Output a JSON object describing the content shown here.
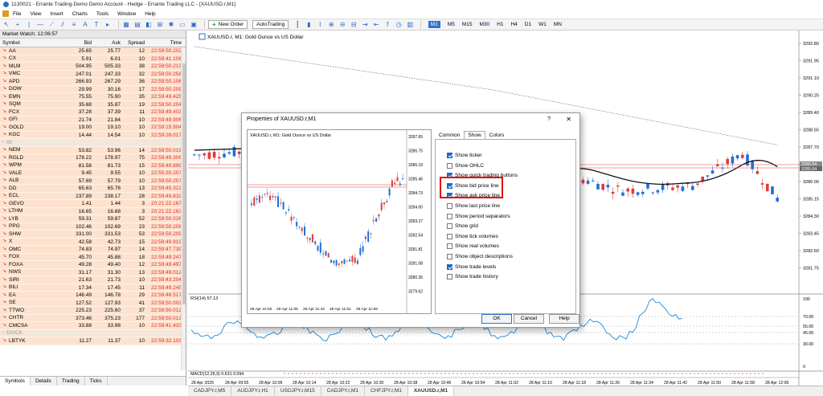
{
  "window": {
    "title": "1130021 - Errante Trading-Demo Demo Account - Hedge - Errante Trading LLC - [XAUUSD.r,M1]"
  },
  "menu": [
    "File",
    "View",
    "Insert",
    "Charts",
    "Tools",
    "Window",
    "Help"
  ],
  "toolbar": {
    "new_order": "New Order",
    "autotrading": "AutoTrading",
    "timeframes": [
      "M1",
      "M5",
      "M15",
      "M30",
      "H1",
      "H4",
      "D1",
      "W1",
      "MN"
    ],
    "active_tf": "M1"
  },
  "market_watch": {
    "title": "Market Watch: 12:06:57",
    "headers": {
      "symbol": "Symbol",
      "bid": "Bid",
      "ask": "Ask",
      "spread": "Spread",
      "time": "Time"
    },
    "rows": [
      {
        "s": "AA",
        "b": "25.65",
        "a": "25.77",
        "sp": "12",
        "t": "22:59:50.202"
      },
      {
        "s": "CX",
        "b": "5.91",
        "a": "6.01",
        "sp": "10",
        "t": "22:59:41.106"
      },
      {
        "s": "MLM",
        "b": "504.95",
        "a": "505.33",
        "sp": "38",
        "t": "22:59:50.213"
      },
      {
        "s": "VMC",
        "b": "247.01",
        "a": "247.33",
        "sp": "32",
        "t": "22:59:50.258"
      },
      {
        "s": "APD",
        "b": "266.93",
        "a": "267.29",
        "sp": "36",
        "t": "22:59:50.106"
      },
      {
        "s": "DOW",
        "b": "29.99",
        "a": "30.16",
        "sp": "17",
        "t": "22:59:50.209"
      },
      {
        "s": "EMN",
        "b": "75.55",
        "a": "75.90",
        "sp": "35",
        "t": "22:59:49.425"
      },
      {
        "s": "SQM",
        "b": "35.68",
        "a": "35.87",
        "sp": "19",
        "t": "22:59:50.204"
      },
      {
        "s": "FCX",
        "b": "37.28",
        "a": "37.39",
        "sp": "11",
        "t": "22:59:49.403"
      },
      {
        "s": "GFI",
        "b": "21.74",
        "a": "21.84",
        "sp": "10",
        "t": "22:59:49.906"
      },
      {
        "s": "GOLD",
        "b": "19.00",
        "a": "19.10",
        "sp": "10",
        "t": "22:59:15.904"
      },
      {
        "s": "KGC",
        "b": "14.44",
        "a": "14.54",
        "sp": "10",
        "t": "22:59:28.017"
      },
      {
        "s": "IG",
        "b": "",
        "a": "",
        "sp": "",
        "t": "",
        "gray": true
      },
      {
        "s": "NEM",
        "b": "53.82",
        "a": "53.96",
        "sp": "14",
        "t": "22:59:50.019"
      },
      {
        "s": "RGLD",
        "b": "178.22",
        "a": "178.97",
        "sp": "75",
        "t": "22:59:49.306"
      },
      {
        "s": "WPM",
        "b": "81.58",
        "a": "81.73",
        "sp": "15",
        "t": "22:59:49.899"
      },
      {
        "s": "VALE",
        "b": "9.45",
        "a": "9.55",
        "sp": "10",
        "t": "22:55:30.207"
      },
      {
        "s": "ALB",
        "b": "57.69",
        "a": "57.79",
        "sp": "10",
        "t": "22:59:50.207"
      },
      {
        "s": "DD",
        "b": "65.63",
        "a": "65.76",
        "sp": "13",
        "t": "22:59:45.322"
      },
      {
        "s": "ECL",
        "b": "237.89",
        "a": "238.17",
        "sp": "28",
        "t": "22:59:49.832"
      },
      {
        "s": "GEVO",
        "b": "1.41",
        "a": "1.44",
        "sp": "3",
        "t": "20:21:22.167"
      },
      {
        "s": "LTHM",
        "b": "16.65",
        "a": "16.68",
        "sp": "3",
        "t": "20:21:22.163"
      },
      {
        "s": "LYB",
        "b": "59.31",
        "a": "59.87",
        "sp": "52",
        "t": "22:59:50.026"
      },
      {
        "s": "PPG",
        "b": "102.46",
        "a": "102.69",
        "sp": "23",
        "t": "22:59:50.208"
      },
      {
        "s": "SHW",
        "b": "331.00",
        "a": "331.53",
        "sp": "53",
        "t": "22:59:50.209"
      },
      {
        "s": "X",
        "b": "42.58",
        "a": "42.73",
        "sp": "15",
        "t": "22:59:49.919"
      },
      {
        "s": "OMC",
        "b": "74.83",
        "a": "74.97",
        "sp": "14",
        "t": "22:59:47.739"
      },
      {
        "s": "FOX",
        "b": "45.70",
        "a": "45.88",
        "sp": "18",
        "t": "22:59:49.247"
      },
      {
        "s": "FOXA",
        "b": "49.28",
        "a": "49.40",
        "sp": "12",
        "t": "22:59:49.497"
      },
      {
        "s": "NWS",
        "b": "31.17",
        "a": "31.30",
        "sp": "13",
        "t": "22:59:49.012"
      },
      {
        "s": "SIRI",
        "b": "21.63",
        "a": "21.73",
        "sp": "10",
        "t": "22:59:43.204"
      },
      {
        "s": "BILI",
        "b": "17.34",
        "a": "17.45",
        "sp": "11",
        "t": "22:59:49.245"
      },
      {
        "s": "EA",
        "b": "146.49",
        "a": "146.78",
        "sp": "29",
        "t": "22:59:48.517"
      },
      {
        "s": "SE",
        "b": "127.52",
        "a": "127.93",
        "sp": "41",
        "t": "22:59:50.003"
      },
      {
        "s": "TTWO",
        "b": "225.23",
        "a": "225.60",
        "sp": "37",
        "t": "22:59:50.012"
      },
      {
        "s": "CHTR",
        "b": "373.46",
        "a": "375.23",
        "sp": "177",
        "t": "22:59:50.012"
      },
      {
        "s": "CMCSA",
        "b": "33.88",
        "a": "33.98",
        "sp": "10",
        "t": "22:59:41.433"
      },
      {
        "s": "DISCK",
        "b": "",
        "a": "",
        "sp": "",
        "t": "",
        "gray": true
      },
      {
        "s": "LBTYK",
        "b": "11.27",
        "a": "11.37",
        "sp": "10",
        "t": "22:59:32.103"
      }
    ],
    "tabs": [
      "Symbols",
      "Details",
      "Trading",
      "Ticks"
    ]
  },
  "chart": {
    "label": "XAUUSD.r, M1: Gold Ounce vs US Dollar",
    "price_labels": [
      "3292.80",
      "3291.95",
      "3291.10",
      "3290.25",
      "3289.40",
      "3288.55",
      "3287.70",
      "3286.85",
      "3286.00",
      "3285.15",
      "3284.30",
      "3283.45",
      "3282.60",
      "3281.75"
    ],
    "bid_tag": "3285.94",
    "ask_tag": "3285.64",
    "time_labels": [
      "28 Apr 2025",
      "28 Apr 09:55",
      "28 Apr 10:06",
      "28 Apr 10:14",
      "28 Apr 10:22",
      "28 Apr 10:30",
      "28 Apr 10:38",
      "28 Apr 10:46",
      "28 Apr 10:54",
      "28 Apr 11:02",
      "28 Apr 11:10",
      "28 Apr 11:18",
      "28 Apr 11:26",
      "28 Apr 11:34",
      "28 Apr 11:42",
      "28 Apr 11:50",
      "28 Apr 11:58",
      "28 Apr 12:06"
    ],
    "rsi_label": "RSI(14) 57.13",
    "rsi_levels": [
      "100",
      "70.00",
      "55.00",
      "45.00",
      "30.00",
      "0"
    ],
    "macd_label": "MACD(12,26,9) 0.631 0.094",
    "tabs": [
      "CADJPY.r,M5",
      "AUDJPY.r,H1",
      "USDJPY.r,M15",
      "CADJPY.r,M1",
      "CHFJPY.r,M1",
      "XAUUSD.r,M1"
    ],
    "active_tab": "XAUUSD.r,M1"
  },
  "dialog": {
    "title": "Properties of XAUUSD.r,M1",
    "help": "?",
    "preview_label": "XAUUSD.r, M1: Gold Ounce vs US Dollar",
    "preview_prices": [
      "3287.65",
      "3286.75",
      "3286.19",
      "3285.46",
      "3284.73",
      "3284.00",
      "3283.27",
      "3282.54",
      "3281.81",
      "3281.08",
      "3280.35",
      "3279.62"
    ],
    "preview_times": [
      "28 Apr 10:28",
      "28 Apr 11:05",
      "28 Apr 11:43",
      "28 Apr 11:51",
      "28 Apr 11:59"
    ],
    "tabs": [
      "Common",
      "Show",
      "Colors"
    ],
    "active_tab": "Show",
    "options": [
      {
        "label": "Show ticker",
        "checked": true
      },
      {
        "label": "Show OHLC",
        "checked": false
      },
      {
        "label": "Show quick trading buttons",
        "checked": true
      },
      {
        "label": "Show bid price line",
        "checked": true
      },
      {
        "label": "Show ask price line",
        "checked": true
      },
      {
        "label": "Show last price line",
        "checked": false
      },
      {
        "label": "Show period separators",
        "checked": false
      },
      {
        "label": "Show grid",
        "checked": false
      },
      {
        "label": "Show tick volumes",
        "checked": false
      },
      {
        "label": "Show real volumes",
        "checked": false
      },
      {
        "label": "Show object descriptions",
        "checked": false
      },
      {
        "label": "Show trade levels",
        "checked": true
      },
      {
        "label": "Show trade history",
        "checked": false
      }
    ],
    "buttons": {
      "ok": "OK",
      "cancel": "Cancel",
      "help": "Help"
    }
  },
  "colors": {
    "bull": "#1f6fd6",
    "bear": "#e03a3a",
    "accent": "#2f73c9",
    "highlight": "#e01010"
  }
}
